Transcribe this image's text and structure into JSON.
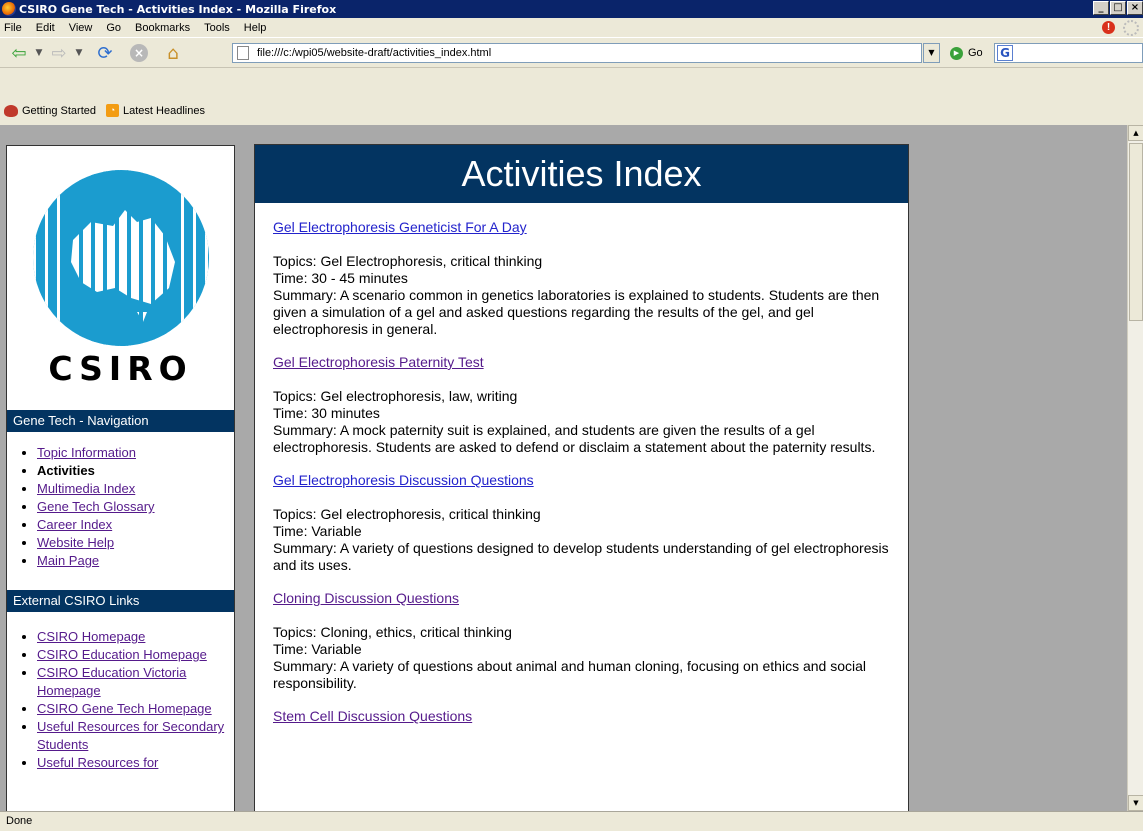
{
  "window": {
    "title": "CSIRO Gene Tech - Activities Index - Mozilla Firefox"
  },
  "menu": [
    "File",
    "Edit",
    "View",
    "Go",
    "Bookmarks",
    "Tools",
    "Help"
  ],
  "toolbar": {
    "url": "file:///c:/wpi05/website-draft/activities_index.html",
    "go_label": "Go"
  },
  "bookmarks": [
    "Getting Started",
    "Latest Headlines"
  ],
  "sidebar": {
    "logo_text": "CSIRO",
    "nav_heading": "Gene Tech - Navigation",
    "nav_items": [
      {
        "label": "Topic Information",
        "current": false
      },
      {
        "label": "Activities",
        "current": true
      },
      {
        "label": "Multimedia Index",
        "current": false
      },
      {
        "label": "Gene Tech Glossary",
        "current": false
      },
      {
        "label": "Career Index",
        "current": false
      },
      {
        "label": "Website Help",
        "current": false
      },
      {
        "label": "Main Page",
        "current": false
      }
    ],
    "links_heading": "External CSIRO Links",
    "links": [
      {
        "label": "CSIRO Homepage"
      },
      {
        "label": "CSIRO Education Homepage"
      },
      {
        "label": "CSIRO Education Victoria Homepage"
      },
      {
        "label": "CSIRO Gene Tech Homepage"
      },
      {
        "label": "Useful Resources for Secondary Students"
      },
      {
        "label": "Useful Resources for"
      }
    ]
  },
  "main": {
    "title": "Activities Index",
    "activities": [
      {
        "title": "Gel Electrophoresis Geneticist For A Day",
        "topics": "Topics: Gel Electrophoresis, critical thinking",
        "time": "Time: 30 - 45 minutes",
        "summary": "Summary: A scenario common in genetics laboratories is explained to students. Students are then given a simulation of a gel and asked questions regarding the results of the gel, and gel electrophoresis in general."
      },
      {
        "title": "Gel Electrophoresis Paternity Test",
        "topics": "Topics: Gel electrophoresis, law, writing",
        "time": "Time: 30 minutes",
        "summary": "Summary: A mock paternity suit is explained, and students are given the results of a gel electrophoresis. Students are asked to defend or disclaim a statement about the paternity results."
      },
      {
        "title": "Gel Electrophoresis Discussion Questions",
        "topics": "Topics: Gel electrophoresis, critical thinking",
        "time": "Time: Variable",
        "summary": "Summary: A variety of questions designed to develop students understanding of gel electrophoresis and its uses."
      },
      {
        "title": "Cloning Discussion Questions",
        "topics": "Topics: Cloning, ethics, critical thinking",
        "time": "Time: Variable",
        "summary": "Summary: A variety of questions about animal and human cloning, focusing on ethics and social responsibility."
      },
      {
        "title": "Stem Cell Discussion Questions",
        "topics": "",
        "time": "",
        "summary": ""
      }
    ]
  },
  "status": {
    "text": "Done"
  }
}
